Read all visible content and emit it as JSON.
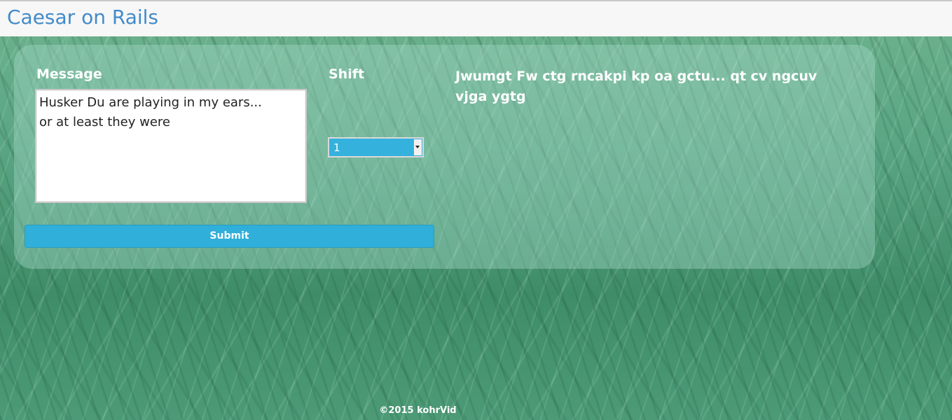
{
  "header": {
    "title": "Caesar on Rails"
  },
  "form": {
    "message_label": "Message",
    "message_value": "Husker Du are playing in my ears...\nor at least they were",
    "shift_label": "Shift",
    "shift_selected": "1",
    "submit_label": "Submit"
  },
  "output": {
    "encrypted_text": "Jwumgt Fw ctg rncakpi kp oa gctu... qt cv ngcuv vjga ygtg"
  },
  "footer": {
    "copyright": "©2015 kohrVid"
  },
  "colors": {
    "title": "#428bca",
    "select_bg": "#34b1dc",
    "button_bg": "#2fafda",
    "panel": "rgba(170,220,205,0.38)"
  }
}
